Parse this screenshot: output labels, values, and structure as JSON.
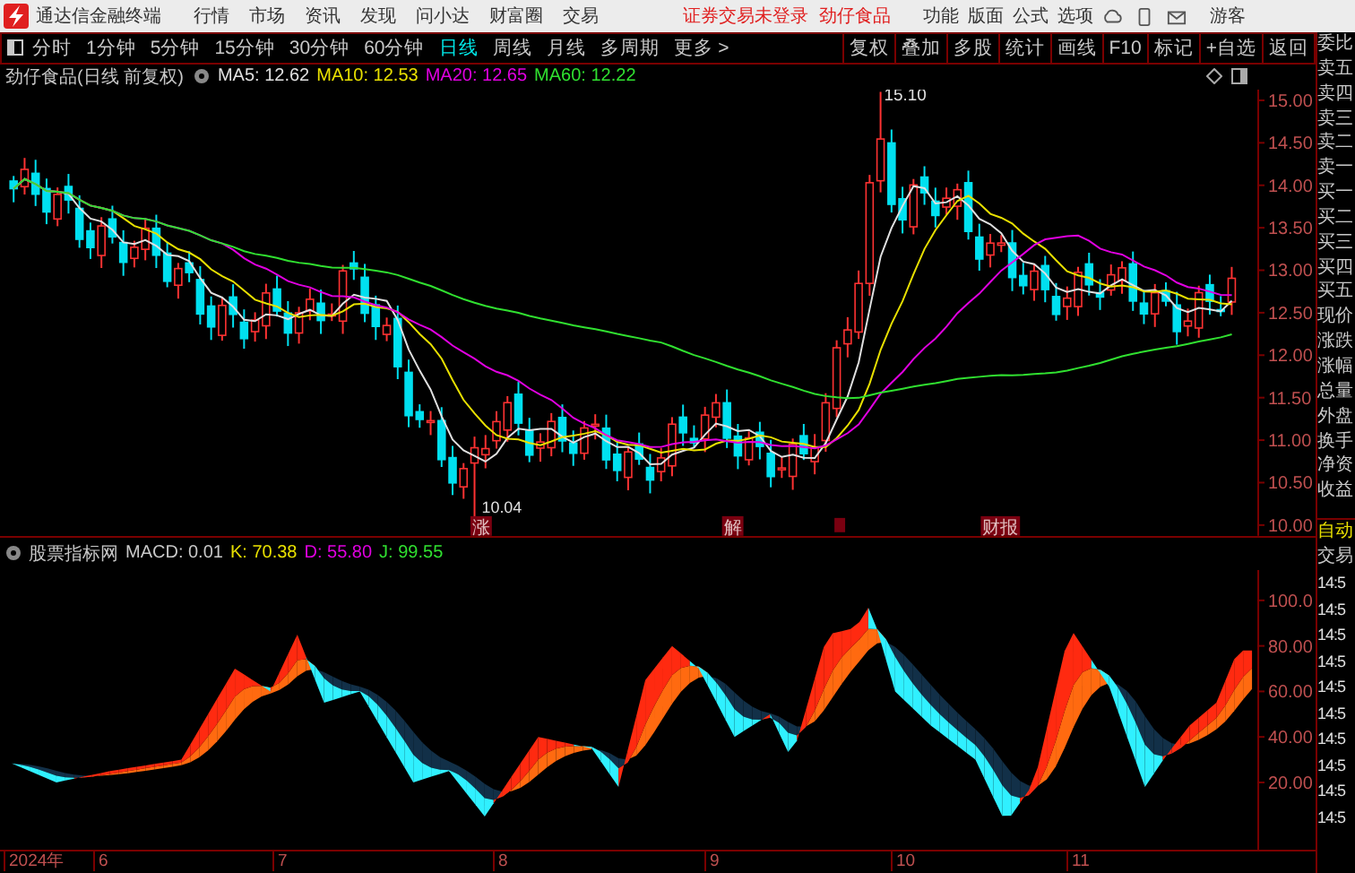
{
  "app": {
    "title": "通达信金融终端"
  },
  "menu": [
    "行情",
    "市场",
    "资讯",
    "发现",
    "问小达",
    "财富圈",
    "交易"
  ],
  "login_notice": "证券交易未登录",
  "stock_header": "劲仔食品",
  "top_menu": [
    "功能",
    "版面",
    "公式",
    "选项"
  ],
  "user": "游客",
  "periods": [
    {
      "label": "分时",
      "selected": false
    },
    {
      "label": "1分钟",
      "selected": false
    },
    {
      "label": "5分钟",
      "selected": false
    },
    {
      "label": "15分钟",
      "selected": false
    },
    {
      "label": "30分钟",
      "selected": false
    },
    {
      "label": "60分钟",
      "selected": false
    },
    {
      "label": "日线",
      "selected": true
    },
    {
      "label": "周线",
      "selected": false
    },
    {
      "label": "月线",
      "selected": false
    },
    {
      "label": "多周期",
      "selected": false
    },
    {
      "label": "更多 >",
      "selected": false
    }
  ],
  "tools": [
    "复权",
    "叠加",
    "多股",
    "统计",
    "画线",
    "F10",
    "标记",
    "+自选",
    "返回"
  ],
  "main_chart": {
    "title": "劲仔食品(日线 前复权)",
    "indicators": [
      {
        "label": "MA5: 12.62",
        "color": "#e0e0e0"
      },
      {
        "label": "MA10: 12.53",
        "color": "#e8e000"
      },
      {
        "label": "MA20: 12.65",
        "color": "#e000e0"
      },
      {
        "label": "MA60: 12.22",
        "color": "#30e030"
      }
    ],
    "price_ticks": [
      "15.00",
      "14.50",
      "14.00",
      "13.50",
      "13.00",
      "12.50",
      "12.00",
      "11.50",
      "11.00",
      "10.50",
      "10.00"
    ],
    "high_label": "15.10",
    "low_label": "10.04",
    "events": [
      {
        "label": "涨"
      },
      {
        "label": "解"
      },
      {
        "label": "财报"
      }
    ]
  },
  "indicator": {
    "title": "股票指标网",
    "values": [
      {
        "label": "MACD: 0.01",
        "color": "#c8c8c8"
      },
      {
        "label": "K: 70.38",
        "color": "#e8e000"
      },
      {
        "label": "D: 55.80",
        "color": "#e000e0"
      },
      {
        "label": "J: 99.55",
        "color": "#30e030"
      }
    ],
    "ticks": [
      "100.0",
      "80.00",
      "60.00",
      "40.00",
      "20.00"
    ]
  },
  "date_axis": [
    "2024年",
    "6",
    "7",
    "8",
    "9",
    "10",
    "11"
  ],
  "quote_panel": {
    "labels": [
      "委比",
      "卖五",
      "卖四",
      "卖三",
      "卖二",
      "卖一",
      "买一",
      "买二",
      "买三",
      "买四",
      "买五",
      "现价",
      "涨跌",
      "涨幅",
      "总量",
      "外盘",
      "换手",
      "净资",
      "收益"
    ],
    "mode": "自动",
    "trade": "交易",
    "times": [
      "14:5",
      "14:5",
      "14:5",
      "14:5",
      "14:5",
      "14:5",
      "14:5",
      "14:5",
      "14:5",
      "14:5"
    ]
  }
}
